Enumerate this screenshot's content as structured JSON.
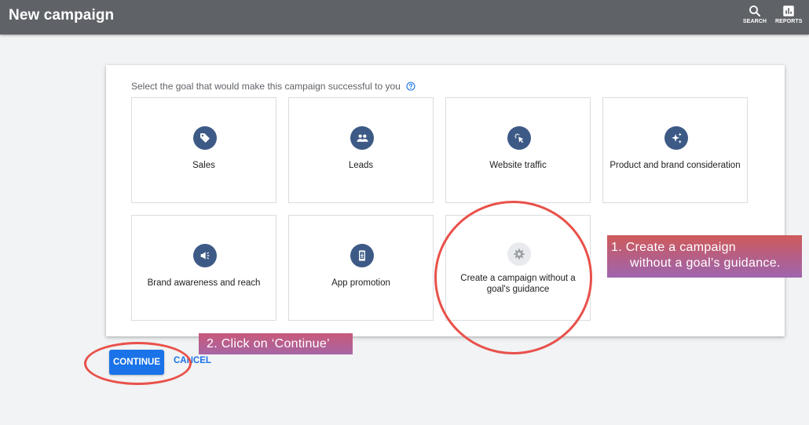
{
  "header": {
    "title": "New campaign",
    "actions": [
      {
        "label": "SEARCH",
        "icon": "search-icon"
      },
      {
        "label": "REPORTS",
        "icon": "reports-icon"
      }
    ]
  },
  "goal_selector": {
    "prompt": "Select the goal that would make this campaign successful to you",
    "help_icon": "help-circle-icon",
    "tiles": [
      {
        "label": "Sales",
        "icon": "tag-icon"
      },
      {
        "label": "Leads",
        "icon": "people-icon"
      },
      {
        "label": "Website traffic",
        "icon": "cursor-click-icon"
      },
      {
        "label": "Product and brand consideration",
        "icon": "sparkle-icon"
      },
      {
        "label": "Brand awareness and reach",
        "icon": "speaker-icon"
      },
      {
        "label": "App promotion",
        "icon": "phone-download-icon"
      },
      {
        "label": "Create a campaign without a goal's guidance",
        "icon": "gear-icon"
      }
    ]
  },
  "annotations": {
    "step1_line1": "1.  Create a campaign",
    "step1_line2": "without a goal’s guidance.",
    "step2": "2. Click on ‘Continue’"
  },
  "footer": {
    "continue_label": "CONTINUE",
    "cancel_label": "CANCEL"
  },
  "colors": {
    "topbar": "#5f6368",
    "icon_badge": "#3d5a86",
    "primary": "#1a73e8",
    "highlight_ring": "#e8514a"
  }
}
